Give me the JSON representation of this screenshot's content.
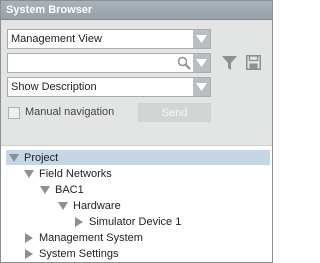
{
  "window": {
    "title": "System Browser"
  },
  "view_select": {
    "value": "Management View"
  },
  "search": {
    "value": ""
  },
  "description_select": {
    "value": "Show Description"
  },
  "manual_navigation": {
    "label": "Manual navigation",
    "checked": false
  },
  "send_button": {
    "label": "Send",
    "enabled": false
  },
  "tree": {
    "nodes": [
      {
        "label": "Project",
        "expanded": true,
        "selected": true
      },
      {
        "label": "Field Networks",
        "expanded": true
      },
      {
        "label": "BAC1",
        "expanded": true
      },
      {
        "label": "Hardware",
        "expanded": true
      },
      {
        "label": "Simulator Device 1",
        "expanded": false
      },
      {
        "label": "Management System",
        "expanded": false
      },
      {
        "label": "System Settings",
        "expanded": false
      }
    ]
  },
  "colors": {
    "titlebar": "#9ca6ad",
    "panel": "#e3e4e4",
    "selection": "#c5d7e6",
    "icon": "#8a9094"
  }
}
